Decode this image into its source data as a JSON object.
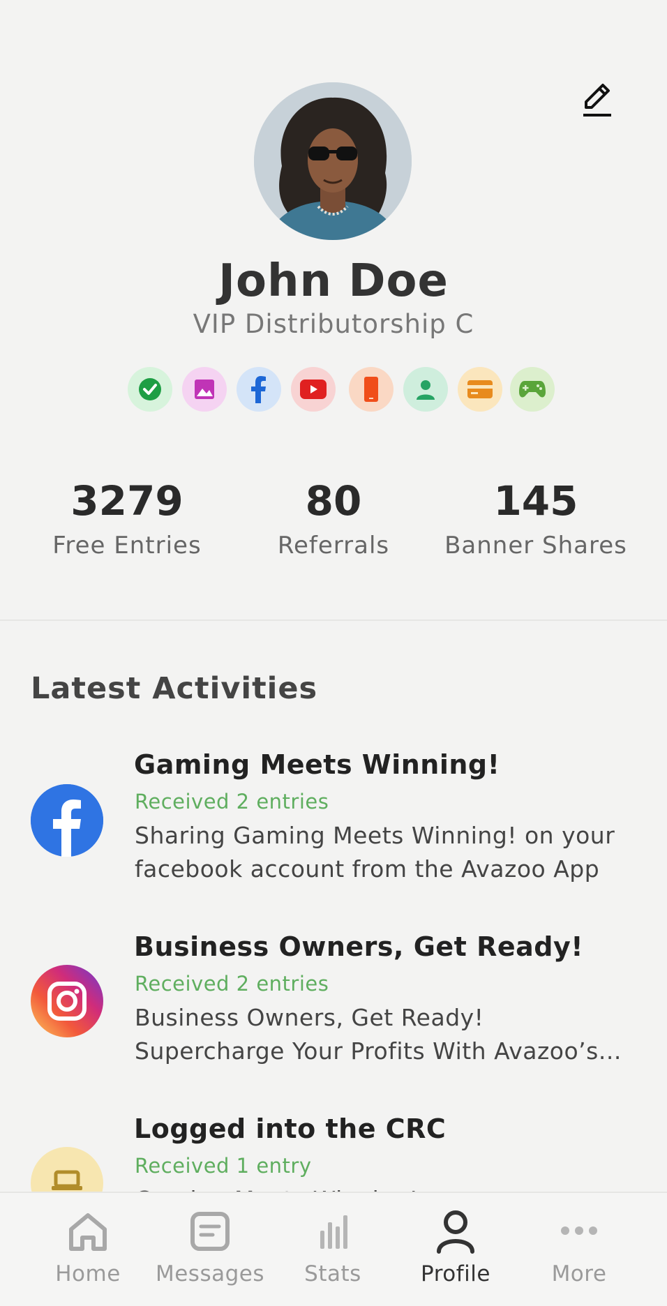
{
  "profile": {
    "name": "John Doe",
    "subtitle": "VIP Distributorship C",
    "edit_icon": "pencil-icon",
    "avatar": "user-photo"
  },
  "badges": [
    {
      "icon": "check-circle-icon",
      "bg": "#d7f3dc",
      "fg": "#1e9e44"
    },
    {
      "icon": "image-icon",
      "bg": "#f5d3f2",
      "fg": "#c034b6"
    },
    {
      "icon": "facebook-icon",
      "bg": "#d4e4f8",
      "fg": "#1d67d6"
    },
    {
      "icon": "youtube-icon",
      "bg": "#f8d3d3",
      "fg": "#e02020"
    },
    {
      "icon": "phone-icon",
      "bg": "#fad8c4",
      "fg": "#f04e1a"
    },
    {
      "icon": "person-icon",
      "bg": "#cfeedd",
      "fg": "#26a364"
    },
    {
      "icon": "card-icon",
      "bg": "#fbe6bd",
      "fg": "#e88b1e"
    },
    {
      "icon": "gamepad-icon",
      "bg": "#dcefcd",
      "fg": "#5aa53a"
    }
  ],
  "stats": [
    {
      "value": "3279",
      "label": "Free Entries"
    },
    {
      "value": "80",
      "label": "Referrals"
    },
    {
      "value": "145",
      "label": "Banner Shares"
    }
  ],
  "latest": {
    "title": "Latest Activities",
    "items": [
      {
        "icon": "facebook-icon",
        "title": "Gaming Meets Winning!",
        "received": "Received 2 entries",
        "desc_line1": "Sharing Gaming Meets Winning! on your",
        "desc_line2": "facebook account from the Avazoo App"
      },
      {
        "icon": "instagram-icon",
        "title": "Business Owners, Get Ready!",
        "received": "Received 2 entries",
        "desc_line1": "Business Owners, Get Ready!",
        "desc_line2": "Supercharge Your Profits With Avazoo’s..."
      },
      {
        "icon": "laptop-icon",
        "title": "Logged into the CRC",
        "received": "Received 1 entry",
        "desc_line1": "Gaming Meets Winning! on",
        "desc_line2": ""
      }
    ]
  },
  "nav": {
    "items": [
      {
        "label": "Home",
        "icon": "home-icon"
      },
      {
        "label": "Messages",
        "icon": "message-icon"
      },
      {
        "label": "Stats",
        "icon": "bar-chart-icon"
      },
      {
        "label": "Profile",
        "icon": "person-icon",
        "active": true
      },
      {
        "label": "More",
        "icon": "more-dots-icon"
      }
    ]
  }
}
